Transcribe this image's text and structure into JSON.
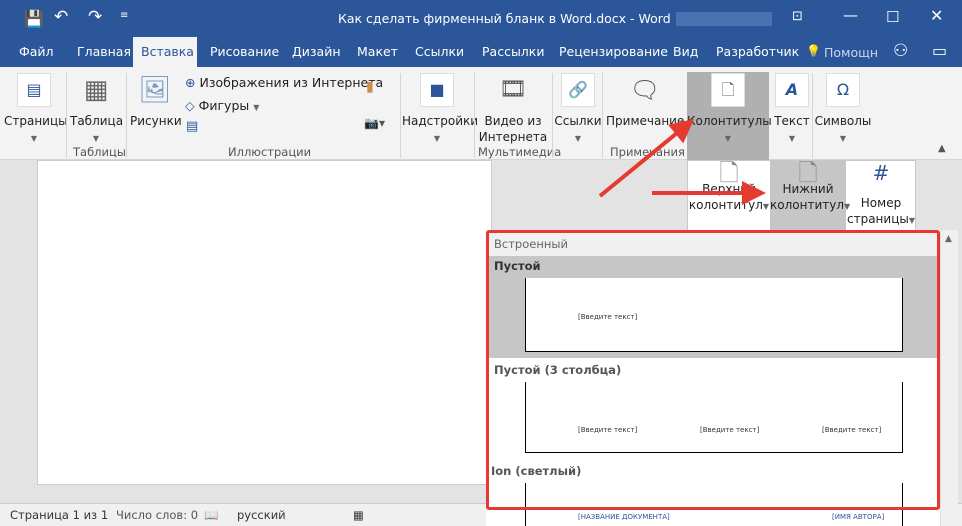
{
  "titlebar": {
    "title": "Как сделать фирменный бланк в Word.docx  -  Word",
    "icons": [
      "save-icon",
      "undo-icon",
      "redo-icon",
      "customize-icon",
      "ribbon-display-icon",
      "minimize-icon",
      "maximize-icon",
      "close-icon"
    ]
  },
  "tabs": [
    {
      "label": "Файл"
    },
    {
      "label": "Главная"
    },
    {
      "label": "Вставка"
    },
    {
      "label": "Рисование"
    },
    {
      "label": "Дизайн"
    },
    {
      "label": "Макет"
    },
    {
      "label": "Ссылки"
    },
    {
      "label": "Рассылки"
    },
    {
      "label": "Рецензирование"
    },
    {
      "label": "Вид"
    },
    {
      "label": "Разработчик"
    }
  ],
  "help": "Помощн",
  "ribbon": {
    "pages": "Страницы",
    "table": "Таблица",
    "pictures": "Рисунки",
    "online_pictures": "Изображения из Интернета",
    "shapes": "Фигуры",
    "addins": "Надстройки",
    "video1": "Видео из",
    "video2": "Интернета",
    "links": "Ссылки",
    "comment": "Примечание",
    "headers": "Колонтитулы",
    "text": "Текст",
    "symbols": "Символы",
    "groups": {
      "tables": "Таблицы",
      "illustrations": "Иллюстрации",
      "media": "Мультимедиа",
      "comments": "Примечания"
    }
  },
  "submenu": {
    "header1": "Верхний",
    "header2": "колонтитул",
    "footer1": "Нижний",
    "footer2": "колонтитул",
    "pagenum1": "Номер",
    "pagenum2": "страницы"
  },
  "gallery": {
    "section": "Встроенный",
    "items": [
      {
        "name": "Пустой",
        "placeholder": "[Введите текст]"
      },
      {
        "name": "Пустой (3 столбца)",
        "placeholders": [
          "[Введите текст]",
          "[Введите текст]",
          "[Введите текст]"
        ]
      },
      {
        "name": "Ion (светлый)",
        "placeholders": [
          "[НАЗВАНИЕ ДОКУМЕНТА]",
          "[ИМЯ АВТОРА]"
        ]
      }
    ]
  },
  "status": {
    "page": "Страница 1 из 1",
    "words": "Число слов: 0",
    "language": "русский"
  },
  "colors": {
    "brand": "#2b579a",
    "highlight": "#e53a2f"
  }
}
